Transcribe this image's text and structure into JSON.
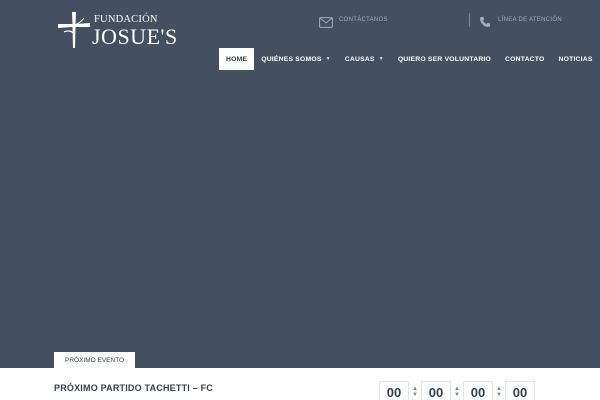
{
  "brand": {
    "line1": "FUNDACIÓN",
    "line2": "JOSUE'S"
  },
  "contact": {
    "email_label": "CONTÁCTANOS",
    "phone_label": "LÍNEA DE ATENCIÓN"
  },
  "nav": {
    "items": [
      {
        "label": "HOME",
        "active": true
      },
      {
        "label": "QUIÉNES SOMOS",
        "dropdown": true
      },
      {
        "label": "CAUSAS",
        "dropdown": true
      },
      {
        "label": "QUIERO SER VOLUNTARIO"
      },
      {
        "label": "CONTACTO"
      },
      {
        "label": "NOTICIAS"
      }
    ]
  },
  "event": {
    "tab_label": "PRÓXIMO EVENTO",
    "title": "PRÓXIMO PARTIDO TACHETTI – FC",
    "countdown": [
      "00",
      "00",
      "00",
      "00"
    ]
  },
  "colors": {
    "background": "#44505f",
    "text_dark": "#35414f",
    "white": "#ffffff"
  }
}
